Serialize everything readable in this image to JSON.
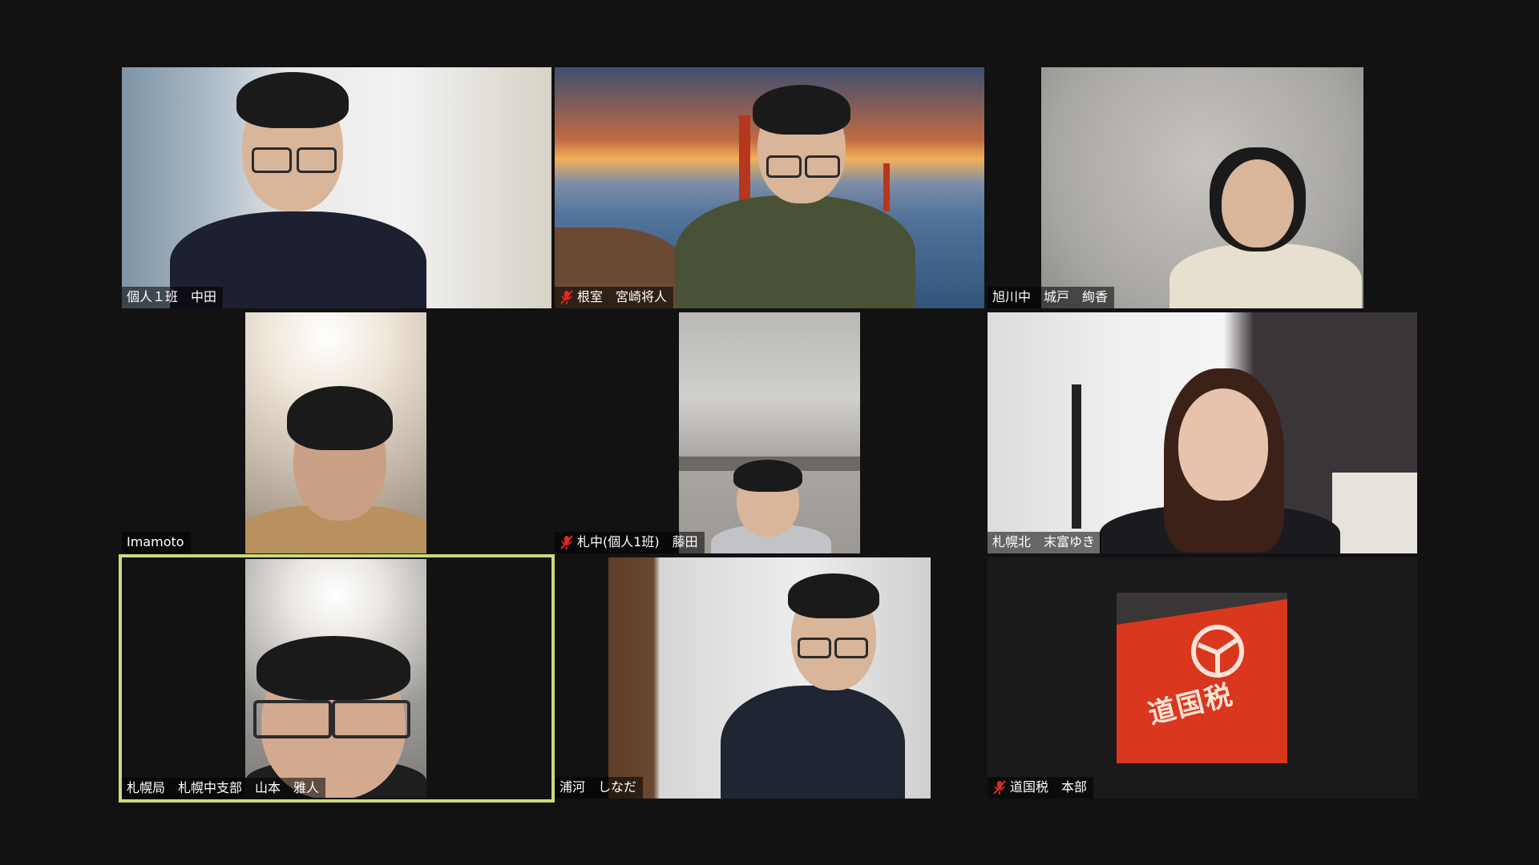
{
  "meeting": {
    "participants": [
      {
        "name": "個人１班　中田",
        "muted": false
      },
      {
        "name": "根室　宮崎将人",
        "muted": true
      },
      {
        "name": "旭川中　城戸　絢香",
        "muted": false
      },
      {
        "name": "Imamoto",
        "muted": false
      },
      {
        "name": "札中(個人1班)　藤田",
        "muted": true
      },
      {
        "name": "札幌北　末富ゆき",
        "muted": false
      },
      {
        "name": "札幌局　札幌中支部　山本　雅人",
        "muted": false,
        "active_speaker": true
      },
      {
        "name": "浦河　しなだ",
        "muted": false
      },
      {
        "name": "道国税　本部",
        "muted": true
      }
    ],
    "flag_text": "道国税",
    "colors": {
      "background": "#121212",
      "active_speaker_border": "#c8dd7a",
      "mute_icon": "#e02828"
    }
  }
}
